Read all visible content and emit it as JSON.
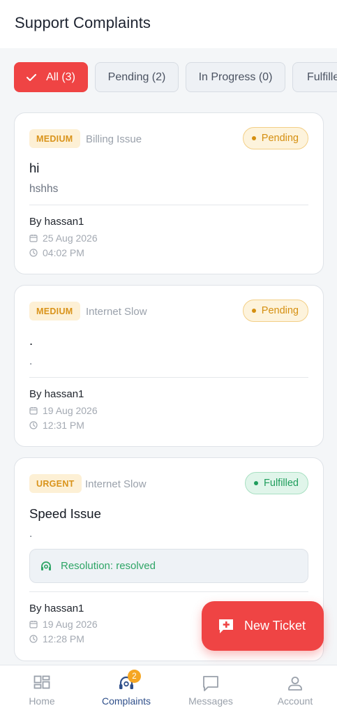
{
  "header": {
    "title": "Support Complaints"
  },
  "filters": [
    {
      "label": "All (3)",
      "active": true
    },
    {
      "label": "Pending (2)",
      "active": false
    },
    {
      "label": "In Progress (0)",
      "active": false
    },
    {
      "label": "Fulfilled",
      "active": false
    }
  ],
  "tickets": [
    {
      "priority": "MEDIUM",
      "category": "Billing Issue",
      "status": "Pending",
      "title": "hi",
      "description": "hshhs",
      "author": "By hassan1",
      "date": "25 Aug 2026",
      "time": "04:02 PM"
    },
    {
      "priority": "MEDIUM",
      "category": "Internet Slow",
      "status": "Pending",
      "title": ".",
      "description": ".",
      "author": "By hassan1",
      "date": "19 Aug 2026",
      "time": "12:31 PM"
    },
    {
      "priority": "URGENT",
      "category": "Internet Slow",
      "status": "Fulfilled",
      "title": "Speed Issue",
      "description": ".",
      "resolution": "Resolution: resolved",
      "author": "By hassan1",
      "date": "19 Aug 2026",
      "time": "12:28 PM"
    }
  ],
  "fab": {
    "label": "New Ticket"
  },
  "nav": {
    "items": [
      {
        "label": "Home",
        "icon": "grid-icon"
      },
      {
        "label": "Complaints",
        "icon": "support-agent-icon",
        "badge": "2"
      },
      {
        "label": "Messages",
        "icon": "chat-bubble-icon"
      },
      {
        "label": "Account",
        "icon": "person-icon"
      }
    ]
  },
  "colors": {
    "primary": "#ef4444",
    "pending": "#d58f10",
    "fulfilled": "#1f9d5c",
    "nav_active": "#2f4f8a",
    "badge": "#f5a623"
  }
}
